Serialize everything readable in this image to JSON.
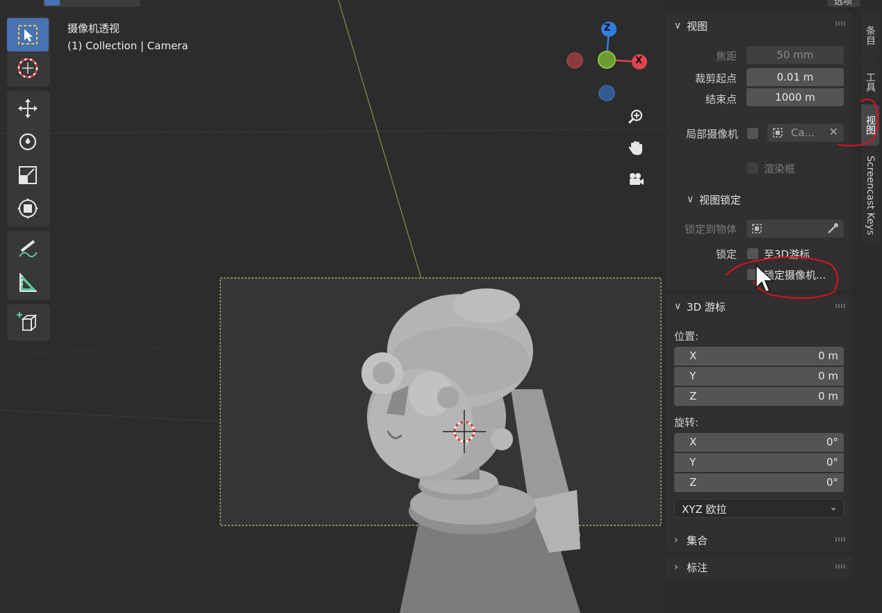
{
  "viewport": {
    "title": "摄像机透视",
    "subtitle": "(1) Collection | Camera"
  },
  "gizmo": {
    "z": "Z",
    "x": "X"
  },
  "tools": [
    "select-box-icon",
    "cursor-icon",
    "move-icon",
    "rotate-icon",
    "scale-icon",
    "transform-icon",
    "annotate-icon",
    "measure-icon",
    "add-cube-icon"
  ],
  "nav_icons": [
    "zoom-icon",
    "hand-pan-icon",
    "camera-view-icon"
  ],
  "top_right": {
    "label": "选项"
  },
  "tabs": {
    "item": "条目",
    "tool": "工具",
    "view": "视图",
    "screencast": "Screencast Keys"
  },
  "view_panel": {
    "header": "视图",
    "focal_label": "焦距",
    "focal_value": "50 mm",
    "clip_start_label": "裁剪起点",
    "clip_start_value": "0.01 m",
    "clip_end_label": "结束点",
    "clip_end_value": "1000 m",
    "local_camera_label": "局部摄像机",
    "local_camera_value": "Ca...",
    "render_region_label": "渲染框",
    "lock_header": "视图锁定",
    "lock_object_label": "锁定到物体",
    "lock_label": "锁定",
    "lock_cursor_label": "至3D游标",
    "lock_camera_label": "锁定摄像机..."
  },
  "cursor_panel": {
    "header": "3D 游标",
    "location_label": "位置:",
    "location": [
      {
        "axis": "X",
        "value": "0 m"
      },
      {
        "axis": "Y",
        "value": "0 m"
      },
      {
        "axis": "Z",
        "value": "0 m"
      }
    ],
    "rotation_label": "旋转:",
    "rotation": [
      {
        "axis": "X",
        "value": "0°"
      },
      {
        "axis": "Y",
        "value": "0°"
      },
      {
        "axis": "Z",
        "value": "0°"
      }
    ],
    "rotation_mode": "XYZ 欧拉"
  },
  "collapsed_panels": {
    "collections": "集合",
    "annotations": "标注"
  },
  "colors": {
    "accent": "#4772b3",
    "annotation_red": "#e0101a",
    "axis_x": "#e0454f",
    "axis_y": "#8ac53b",
    "axis_z": "#2f7fe0"
  }
}
